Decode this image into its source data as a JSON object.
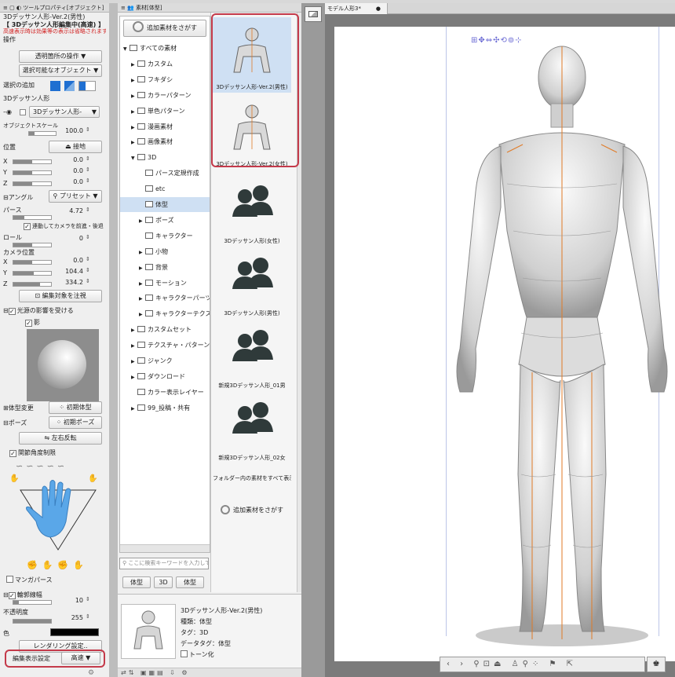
{
  "top_toolbar": {
    "icons": [
      "window-icon",
      "new-icon",
      "save-icon",
      "undo-icon",
      "redo-icon",
      "select-icon",
      "transform-icon",
      "pen-icon",
      "fill-icon",
      "eraser-icon",
      "layer-icon",
      "color-icon"
    ]
  },
  "tool_property": {
    "tab_title": "ツールプロパティ[オブジェクト]",
    "tool_name": "3Dデッサン人形-Ver.2(男性)",
    "edit_mode": "【 3Dデッサン人形編集中(高速) 】",
    "warning": "高速表示時は効果等の表示は省略されます",
    "section_operation": "操作",
    "transparent_op": "透明箇所の操作",
    "selectable_obj": "選択可能なオブジェクト",
    "add_selection": "選択の追加",
    "section_model": "3Dデッサン人形",
    "model_dropdown": "3Dデッサン人形-",
    "object_scale_label": "オブジェクトスケール",
    "object_scale_value": "100.0",
    "position_label": "位置",
    "ground_button": "接地",
    "x_label": "X",
    "x_value": "0.0",
    "y_label": "Y",
    "y_value": "0.0",
    "z_label": "Z",
    "z_value": "0.0",
    "angle_label": "アングル",
    "preset_button": "プリセット",
    "perspective_label": "パース",
    "perspective_value": "4.72",
    "camera_link": "連動してカメラを前進・後退",
    "roll_label": "ロール",
    "roll_value": "0",
    "camera_pos_label": "カメラ位置",
    "cam_x_value": "0.0",
    "cam_y_value": "104.4",
    "cam_z_value": "334.2",
    "focus_button": "編集対象を注視",
    "light_label": "光源の影響を受ける",
    "shadow_label": "影",
    "body_change_label": "体型変更",
    "init_body_button": "初期体型",
    "pose_label": "ポーズ",
    "init_pose_button": "初期ポーズ",
    "flip_button": "左右反転",
    "joint_limit": "関節角度制限",
    "manga_perspective": "マンガパース",
    "outline_width_label": "輪郭線幅",
    "outline_width_value": "10",
    "opacity_label": "不透明度",
    "opacity_value": "255",
    "color_label": "色",
    "rendering_button": "レンダリング設定..",
    "display_setting_label": "編集表示設定",
    "display_setting_value": "高速"
  },
  "material_panel": {
    "tab_title": "素材[体型]",
    "search_more": "追加素材をさがす",
    "tree": [
      {
        "label": "すべての素材",
        "depth": 0,
        "arrow": "▼"
      },
      {
        "label": "カスタム",
        "depth": 1,
        "arrow": "▶"
      },
      {
        "label": "フキダシ",
        "depth": 1,
        "arrow": "▶"
      },
      {
        "label": "カラーパターン",
        "depth": 1,
        "arrow": "▶"
      },
      {
        "label": "単色パターン",
        "depth": 1,
        "arrow": "▶"
      },
      {
        "label": "漫画素材",
        "depth": 1,
        "arrow": "▶"
      },
      {
        "label": "画像素材",
        "depth": 1,
        "arrow": "▶"
      },
      {
        "label": "3D",
        "depth": 1,
        "arrow": "▼"
      },
      {
        "label": "パース定規作成",
        "depth": 2,
        "arrow": ""
      },
      {
        "label": "etc",
        "depth": 2,
        "arrow": ""
      },
      {
        "label": "体型",
        "depth": 2,
        "arrow": "",
        "selected": true
      },
      {
        "label": "ポーズ",
        "depth": 2,
        "arrow": "▶"
      },
      {
        "label": "キャラクター",
        "depth": 2,
        "arrow": ""
      },
      {
        "label": "小物",
        "depth": 2,
        "arrow": "▶"
      },
      {
        "label": "背景",
        "depth": 2,
        "arrow": "▶"
      },
      {
        "label": "モーション",
        "depth": 2,
        "arrow": "▶"
      },
      {
        "label": "キャラクターパーツ",
        "depth": 2,
        "arrow": "▶"
      },
      {
        "label": "キャラクターテクスチャ",
        "depth": 2,
        "arrow": "▶"
      },
      {
        "label": "カスタムセット",
        "depth": 1,
        "arrow": "▶"
      },
      {
        "label": "テクスチャ・パターン",
        "depth": 1,
        "arrow": "▶"
      },
      {
        "label": "ジャンク",
        "depth": 1,
        "arrow": "▶"
      },
      {
        "label": "ダウンロード",
        "depth": 1,
        "arrow": "▶"
      },
      {
        "label": "カラー表示レイヤー",
        "depth": 1,
        "arrow": ""
      },
      {
        "label": "99_投稿・共有",
        "depth": 1,
        "arrow": "▶"
      }
    ],
    "search_placeholder": "ここに検索キーワードを入力して",
    "tags": [
      "体型",
      "3D",
      "体型"
    ],
    "items": [
      {
        "label": "3Dデッサン人形-Ver.2(男性)",
        "kind": "male"
      },
      {
        "label": "3Dデッサン人形-Ver.2(女性)",
        "kind": "female"
      },
      {
        "label": "3Dデッサン人形(女性)",
        "kind": "pair"
      },
      {
        "label": "3Dデッサン人形(男性)",
        "kind": "pair"
      },
      {
        "label": "新規3Dデッサン人形_01男",
        "kind": "pair"
      },
      {
        "label": "新規3Dデッサン人形_02女",
        "kind": "pair"
      },
      {
        "label": "フォルダー内の素材をすべて表示",
        "kind": "text"
      }
    ],
    "search_more_bottom": "追加素材をさがす",
    "detail": {
      "name": "3Dデッサン人形-Ver.2(男性)",
      "type": "種類：体型",
      "tag": "タグ：3D",
      "datatag": "データタグ：体型",
      "tone": "トーン化"
    }
  },
  "canvas": {
    "tab_title": "モデル人形3*",
    "tab_modified": "●"
  }
}
